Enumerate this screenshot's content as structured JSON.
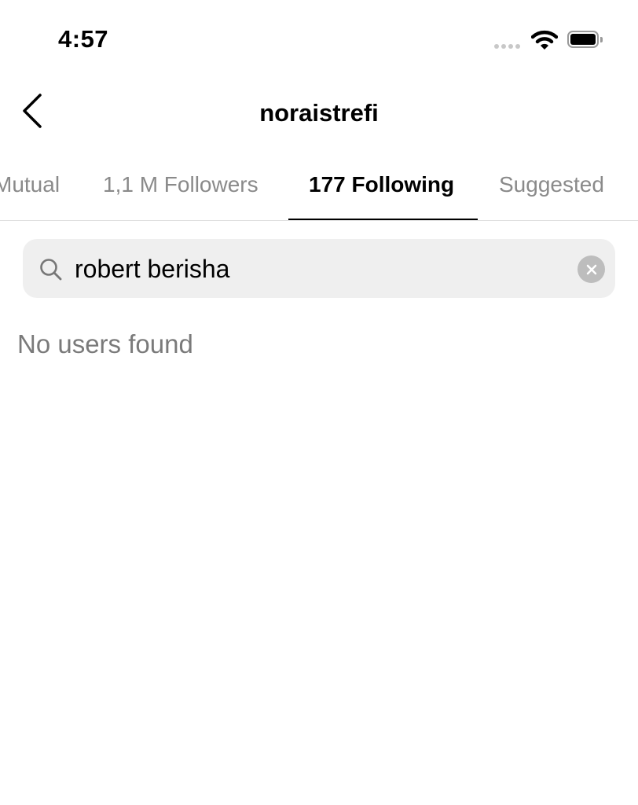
{
  "status_bar": {
    "time": "4:57",
    "icons": [
      "signal-icon",
      "wifi-icon",
      "battery-icon"
    ]
  },
  "header": {
    "title": "noraistrefi",
    "back_icon": "chevron-left-icon"
  },
  "tabs": [
    {
      "label": "Mutual",
      "active": false
    },
    {
      "label": "1,1 M Followers",
      "active": false
    },
    {
      "label": "177 Following",
      "active": true
    },
    {
      "label": "Suggested",
      "active": false
    }
  ],
  "search": {
    "value": "robert berisha",
    "icon": "search-icon",
    "clear_icon": "clear-icon"
  },
  "results": {
    "empty_message": "No users found"
  }
}
